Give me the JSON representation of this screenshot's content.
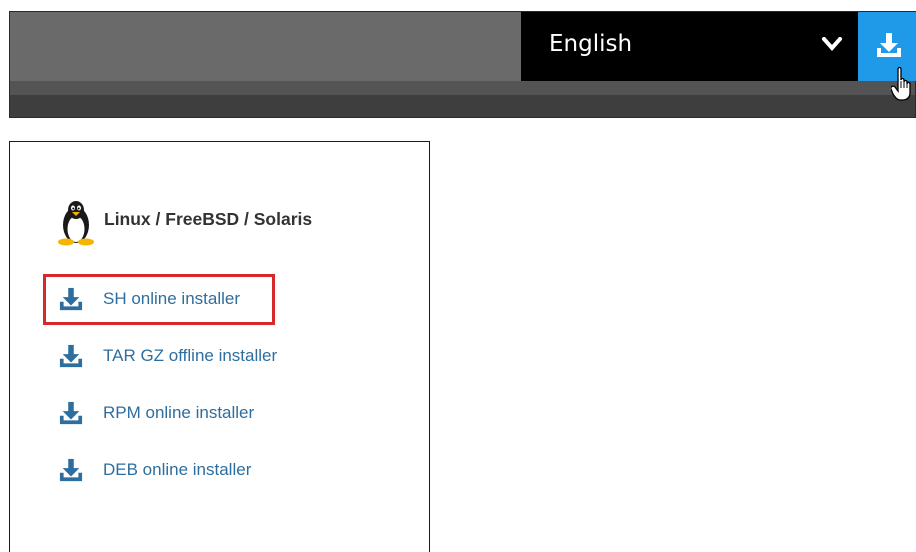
{
  "header": {
    "language": "English",
    "chevron_icon": "chevron-down-icon",
    "download_icon": "download-icon",
    "accent_color": "#1e9ae8"
  },
  "panel": {
    "os_icon": "tux-penguin-icon",
    "title": "Linux / FreeBSD / Solaris",
    "installers": [
      {
        "label": "SH online installer",
        "icon": "download-icon",
        "highlighted": true
      },
      {
        "label": "TAR GZ offline installer",
        "icon": "download-icon",
        "highlighted": false
      },
      {
        "label": "RPM online installer",
        "icon": "download-icon",
        "highlighted": false
      },
      {
        "label": "DEB online installer",
        "icon": "download-icon",
        "highlighted": false
      }
    ],
    "link_color": "#2e6e9e",
    "highlight_color": "#d62a2a"
  }
}
